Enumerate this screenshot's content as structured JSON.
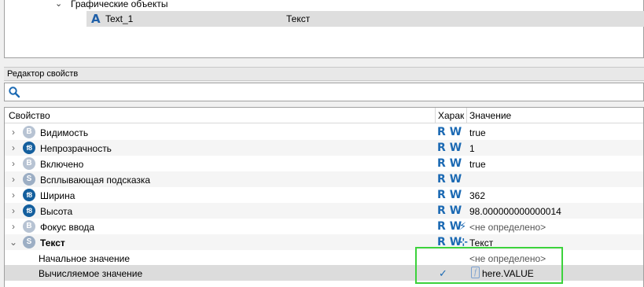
{
  "tree": {
    "group_label": "Графические объекты",
    "selected_item": {
      "name": "Text_1",
      "type": "Текст"
    }
  },
  "property_editor": {
    "title": "Редактор свойств",
    "search_value": "",
    "columns": {
      "property": "Свойство",
      "char": "Харак",
      "value": "Значение"
    },
    "rw": {
      "r": "R",
      "w": "W"
    },
    "rows": [
      {
        "label": "Видимость",
        "badge": "B",
        "value": "true"
      },
      {
        "label": "Непрозрачность",
        "badge": "f8",
        "value": "1"
      },
      {
        "label": "Включено",
        "badge": "B",
        "value": "true"
      },
      {
        "label": "Всплывающая подсказка",
        "badge": "S",
        "value": ""
      },
      {
        "label": "Ширина",
        "badge": "f8",
        "value": "362"
      },
      {
        "label": "Высота",
        "badge": "f8",
        "value": "98.000000000000014"
      },
      {
        "label": "Фокус ввода",
        "badge": "B",
        "value": "<не определено>"
      },
      {
        "label": "Текст",
        "badge": "S",
        "value": "Текст"
      },
      {
        "label": "Начальное значение",
        "value": "<не определено>"
      },
      {
        "label": "Вычисляемое значение",
        "value": "here.VALUE"
      }
    ]
  },
  "colors": {
    "accent": "#1b69b3",
    "highlight": "#3cd23c",
    "selection": "#dcdcdc"
  }
}
